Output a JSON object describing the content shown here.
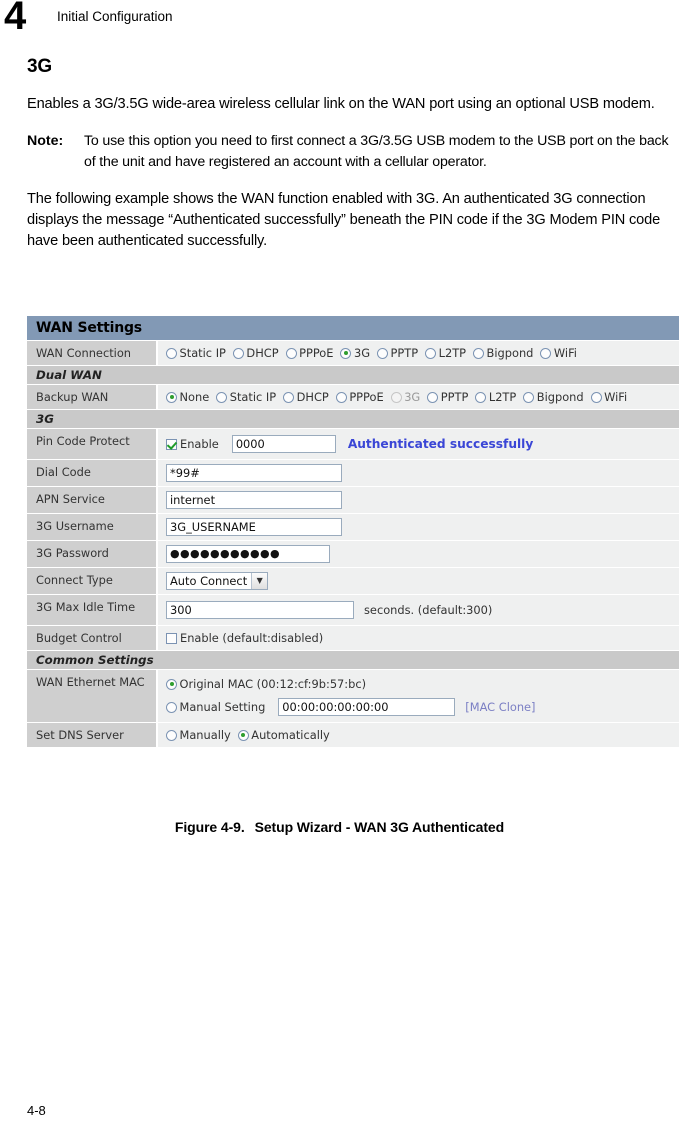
{
  "header": {
    "chapter_number": "4",
    "chapter_title": "Initial Configuration"
  },
  "section": {
    "title": "3G",
    "intro": "Enables a 3G/3.5G wide-area wireless cellular link on the WAN port using an optional USB modem.",
    "note_label": "Note:",
    "note_text": "To use this option you need to first connect a 3G/3.5G USB modem to the USB port on the back of the unit and have registered an account with a cellular operator.",
    "example_para": "The following example shows the WAN function enabled with 3G. An authenticated 3G connection displays the message “Authenticated successfully” beneath the PIN code if the 3G Modem PIN code have been authenticated successfully."
  },
  "panel": {
    "title": "WAN Settings",
    "sections": {
      "dual_wan": "Dual WAN",
      "three_g": "3G",
      "common": "Common Settings"
    },
    "wan_connection": {
      "label": "WAN Connection",
      "options": [
        {
          "label": "Static IP",
          "selected": false,
          "disabled": false
        },
        {
          "label": "DHCP",
          "selected": false,
          "disabled": false
        },
        {
          "label": "PPPoE",
          "selected": false,
          "disabled": false
        },
        {
          "label": "3G",
          "selected": true,
          "disabled": false
        },
        {
          "label": "PPTP",
          "selected": false,
          "disabled": false
        },
        {
          "label": "L2TP",
          "selected": false,
          "disabled": false
        },
        {
          "label": "Bigpond",
          "selected": false,
          "disabled": false
        },
        {
          "label": "WiFi",
          "selected": false,
          "disabled": false
        }
      ]
    },
    "backup_wan": {
      "label": "Backup WAN",
      "options": [
        {
          "label": "None",
          "selected": true,
          "disabled": false
        },
        {
          "label": "Static IP",
          "selected": false,
          "disabled": false
        },
        {
          "label": "DHCP",
          "selected": false,
          "disabled": false
        },
        {
          "label": "PPPoE",
          "selected": false,
          "disabled": false
        },
        {
          "label": "3G",
          "selected": false,
          "disabled": true
        },
        {
          "label": "PPTP",
          "selected": false,
          "disabled": false
        },
        {
          "label": "L2TP",
          "selected": false,
          "disabled": false
        },
        {
          "label": "Bigpond",
          "selected": false,
          "disabled": false
        },
        {
          "label": "WiFi",
          "selected": false,
          "disabled": false
        }
      ]
    },
    "pin_code_protect": {
      "label": "Pin Code Protect",
      "enable_label": "Enable",
      "enabled": true,
      "pin_value": "0000",
      "status": "Authenticated successfully",
      "status_color": "#3a46d6"
    },
    "dial_code": {
      "label": "Dial Code",
      "value": "*99#"
    },
    "apn_service": {
      "label": "APN Service",
      "value": "internet"
    },
    "username": {
      "label": "3G Username",
      "value": "3G_USERNAME"
    },
    "password": {
      "label": "3G Password",
      "value": "●●●●●●●●●●●"
    },
    "connect_type": {
      "label": "Connect Type",
      "value": "Auto Connect"
    },
    "max_idle_time": {
      "label": "3G Max Idle Time",
      "value": "300",
      "hint": "seconds. (default:300)"
    },
    "budget_control": {
      "label": "Budget Control",
      "enable_label": "Enable (default:disabled)",
      "enabled": false
    },
    "wan_ethernet_mac": {
      "label": "WAN Ethernet MAC",
      "original_label": "Original MAC (00:12:cf:9b:57:bc)",
      "original_selected": true,
      "manual_label": "Manual Setting",
      "manual_selected": false,
      "manual_value": "00:00:00:00:00:00",
      "clone_link": "[MAC Clone]"
    },
    "set_dns_server": {
      "label": "Set DNS Server",
      "options": [
        {
          "label": "Manually",
          "selected": false
        },
        {
          "label": "Automatically",
          "selected": true
        }
      ]
    }
  },
  "figure": {
    "number": "Figure 4-9.",
    "caption": "Setup Wizard - WAN 3G Authenticated"
  },
  "footer": {
    "page_number": "4-8"
  }
}
